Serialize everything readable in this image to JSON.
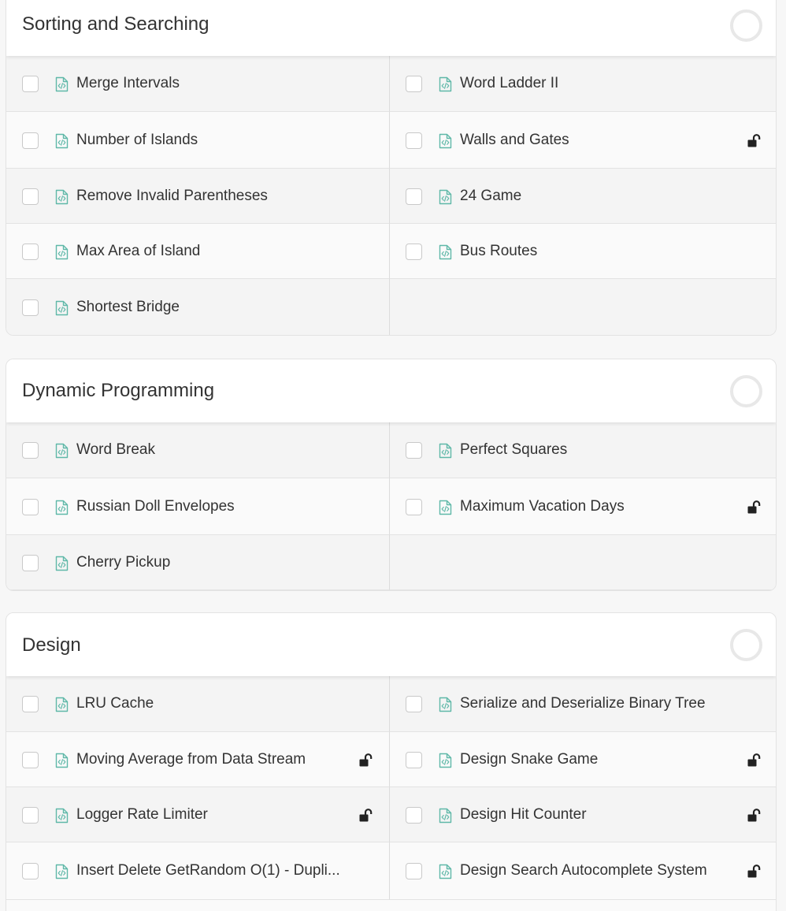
{
  "sections": [
    {
      "title": "Sorting and Searching",
      "items": [
        {
          "label": "Merge Intervals",
          "locked": false
        },
        {
          "label": "Word Ladder II",
          "locked": false
        },
        {
          "label": "Number of Islands",
          "locked": false
        },
        {
          "label": "Walls and Gates",
          "locked": true
        },
        {
          "label": "Remove Invalid Parentheses",
          "locked": false
        },
        {
          "label": "24 Game",
          "locked": false
        },
        {
          "label": "Max Area of Island",
          "locked": false
        },
        {
          "label": "Bus Routes",
          "locked": false
        },
        {
          "label": "Shortest Bridge",
          "locked": false
        }
      ]
    },
    {
      "title": "Dynamic Programming",
      "items": [
        {
          "label": "Word Break",
          "locked": false
        },
        {
          "label": "Perfect Squares",
          "locked": false
        },
        {
          "label": "Russian Doll Envelopes",
          "locked": false
        },
        {
          "label": "Maximum Vacation Days",
          "locked": true
        },
        {
          "label": "Cherry Pickup",
          "locked": false
        }
      ]
    },
    {
      "title": "Design",
      "items": [
        {
          "label": "LRU Cache",
          "locked": false
        },
        {
          "label": "Serialize and Deserialize Binary Tree",
          "locked": false
        },
        {
          "label": "Moving Average from Data Stream",
          "locked": true
        },
        {
          "label": "Design Snake Game",
          "locked": true
        },
        {
          "label": "Logger Rate Limiter",
          "locked": true
        },
        {
          "label": "Design Hit Counter",
          "locked": true
        },
        {
          "label": "Insert Delete GetRandom O(1) - Dupli...",
          "locked": false
        },
        {
          "label": "Design Search Autocomplete System",
          "locked": true
        }
      ]
    }
  ],
  "colors": {
    "doc_icon": "#5fb8a8",
    "lock_icon": "#222222"
  }
}
